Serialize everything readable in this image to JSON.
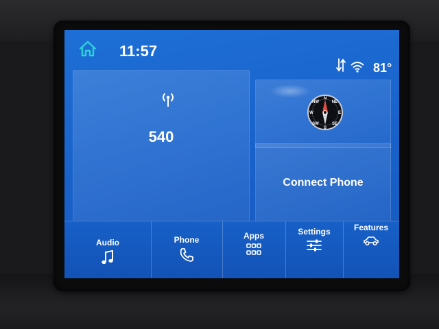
{
  "status": {
    "time": "11:57",
    "temperature": "81°",
    "icons": [
      "home-icon",
      "sync-arrows-icon",
      "wifi-icon"
    ]
  },
  "radio_tile": {
    "icon": "radio-antenna-icon",
    "station": "540"
  },
  "compass_tile": {
    "icon": "compass-icon",
    "markings": [
      "N",
      "NE",
      "E",
      "SE",
      "S",
      "SW",
      "W",
      "NW"
    ]
  },
  "phone_tile": {
    "label": "Connect Phone"
  },
  "nav": {
    "items": [
      {
        "label": "Audio",
        "icon": "music-note-icon"
      },
      {
        "label": "Phone",
        "icon": "phone-handset-icon"
      },
      {
        "label": "Apps",
        "icon": "apps-grid-icon"
      },
      {
        "label": "Settings",
        "icon": "sliders-icon"
      },
      {
        "label": "Features",
        "icon": "car-icon"
      }
    ]
  },
  "colors": {
    "screen_blue": "#1a63cc",
    "text": "#ffffff",
    "accent_teal": "#2fd1d8"
  }
}
